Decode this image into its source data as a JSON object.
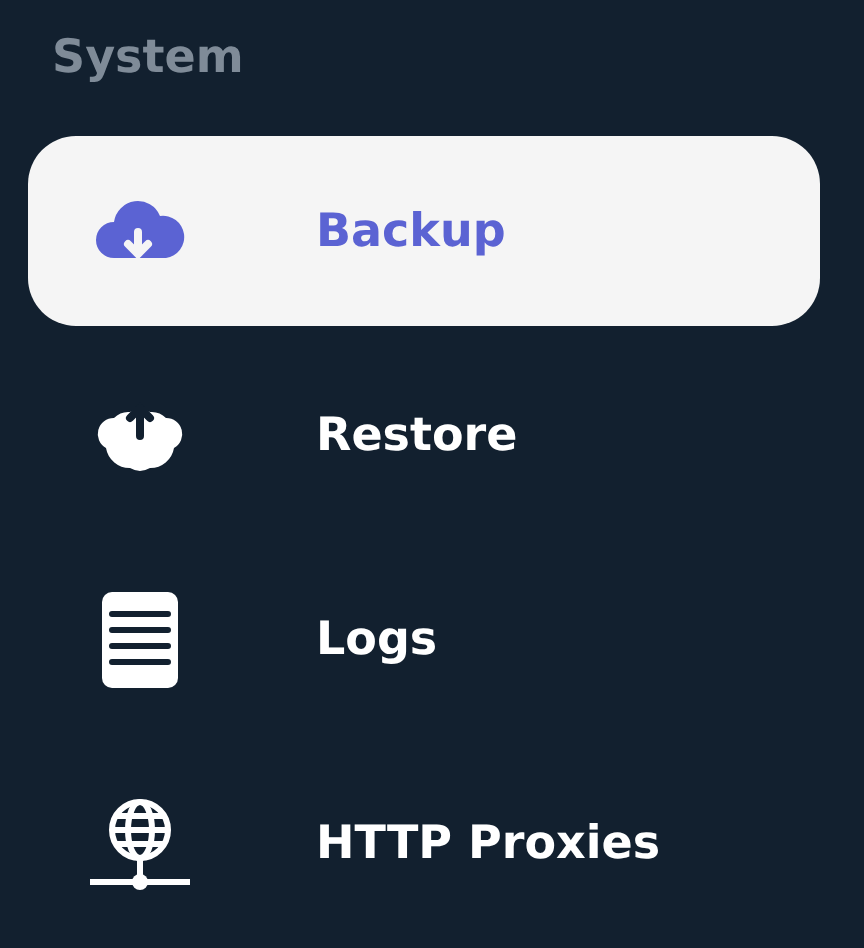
{
  "section": {
    "title": "System"
  },
  "items": [
    {
      "label": "Backup",
      "kind": "backup",
      "selected": true
    },
    {
      "label": "Restore",
      "kind": "restore",
      "selected": false
    },
    {
      "label": "Logs",
      "kind": "logs",
      "selected": false
    },
    {
      "label": "HTTP Proxies",
      "kind": "proxies",
      "selected": false
    }
  ]
}
